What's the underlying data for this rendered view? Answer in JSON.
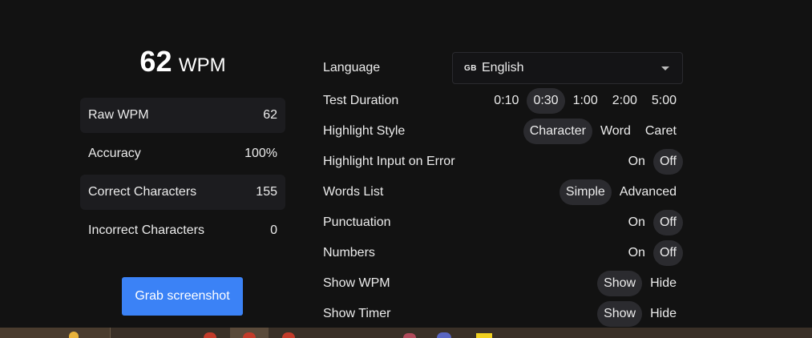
{
  "result": {
    "wpm": "62",
    "unit": "WPM"
  },
  "stats": [
    {
      "label": "Raw WPM",
      "value": "62"
    },
    {
      "label": "Accuracy",
      "value": "100%"
    },
    {
      "label": "Correct Characters",
      "value": "155"
    },
    {
      "label": "Incorrect Characters",
      "value": "0"
    }
  ],
  "grab_button": "Grab screenshot",
  "settings": {
    "language": {
      "label": "Language",
      "flag": "GB",
      "value": "English"
    },
    "duration": {
      "label": "Test Duration",
      "options": [
        "0:10",
        "0:30",
        "1:00",
        "2:00",
        "5:00"
      ],
      "selected": "0:30"
    },
    "highlight_style": {
      "label": "Highlight Style",
      "options": [
        "Character",
        "Word",
        "Caret"
      ],
      "selected": "Character"
    },
    "highlight_error": {
      "label": "Highlight Input on Error",
      "options": [
        "On",
        "Off"
      ],
      "selected": "Off"
    },
    "words_list": {
      "label": "Words List",
      "options": [
        "Simple",
        "Advanced"
      ],
      "selected": "Simple"
    },
    "punctuation": {
      "label": "Punctuation",
      "options": [
        "On",
        "Off"
      ],
      "selected": "Off"
    },
    "numbers": {
      "label": "Numbers",
      "options": [
        "On",
        "Off"
      ],
      "selected": "Off"
    },
    "show_wpm": {
      "label": "Show WPM",
      "options": [
        "Show",
        "Hide"
      ],
      "selected": "Show"
    },
    "show_timer": {
      "label": "Show Timer",
      "options": [
        "Show",
        "Hide"
      ],
      "selected": "Show"
    }
  },
  "colors": {
    "background": "#121212",
    "accent": "#3b82f6",
    "selected_pill": "#2b2b2f"
  }
}
